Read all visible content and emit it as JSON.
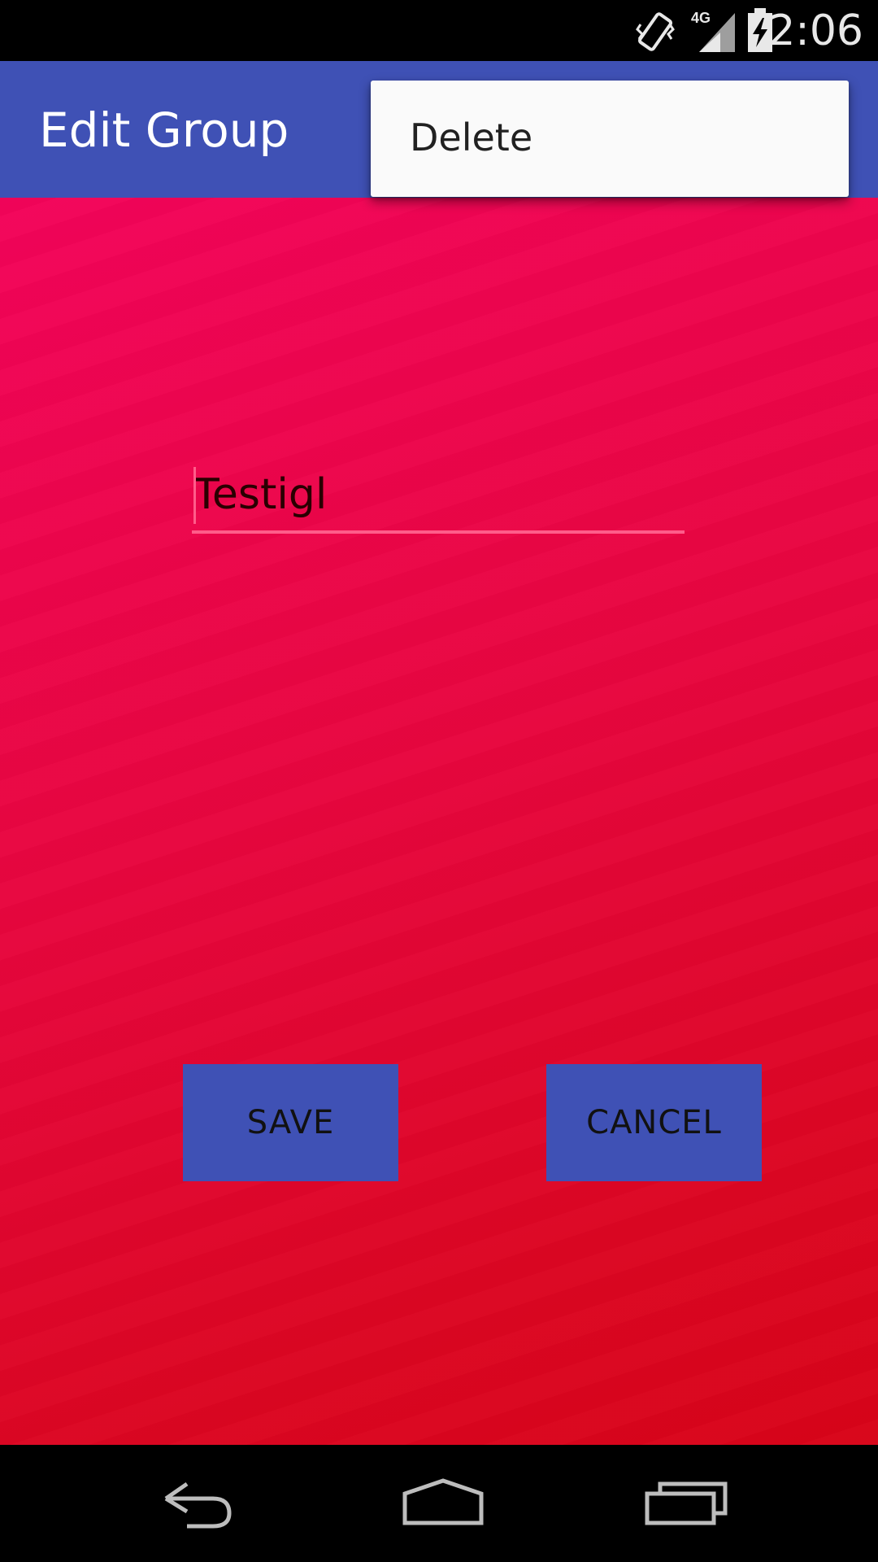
{
  "status_bar": {
    "time": "2:06",
    "network_label": "4G",
    "icons": [
      "vibrate-icon",
      "signal-icon",
      "battery-charging-icon"
    ]
  },
  "app_bar": {
    "title": "Edit Group",
    "color": "#3f51b5"
  },
  "popup_menu": {
    "items": [
      {
        "label": "Delete"
      }
    ]
  },
  "form": {
    "group_name_value": "Testigl",
    "save_label": "SAVE",
    "cancel_label": "CANCEL",
    "accent_color": "#ff5d8a",
    "background_color": "#e8063f"
  },
  "nav_bar": {
    "icons": [
      "back-icon",
      "home-icon",
      "recents-icon"
    ]
  }
}
